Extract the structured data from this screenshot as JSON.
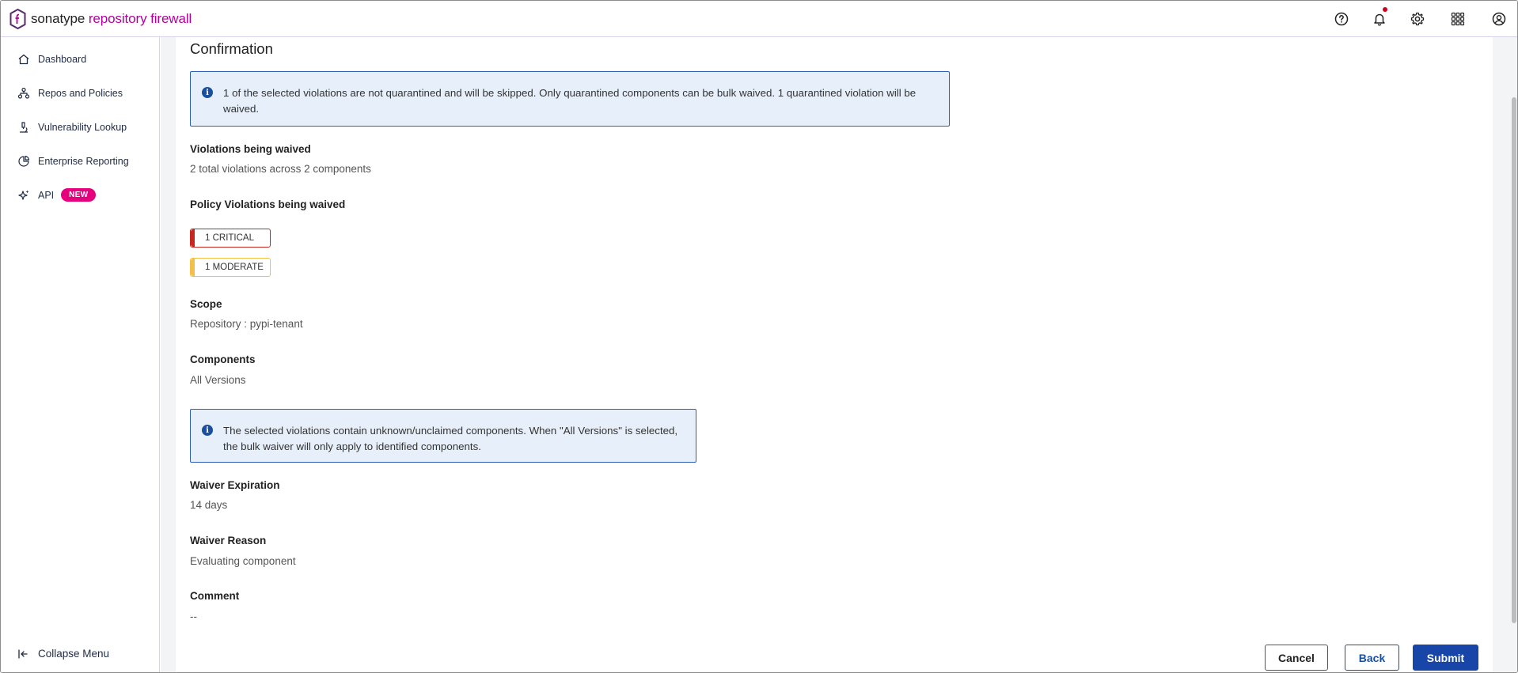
{
  "header": {
    "brand_part1": "sonatype",
    "brand_part2": "repository firewall",
    "icons": [
      "help-icon",
      "bell-icon",
      "gear-icon",
      "apps-grid-icon",
      "user-icon"
    ]
  },
  "sidebar": {
    "items": [
      {
        "label": "Dashboard",
        "icon": "home-icon"
      },
      {
        "label": "Repos and Policies",
        "icon": "hierarchy-icon"
      },
      {
        "label": "Vulnerability Lookup",
        "icon": "microscope-icon"
      },
      {
        "label": "Enterprise Reporting",
        "icon": "report-icon"
      },
      {
        "label": "API",
        "icon": "sparkle-icon",
        "badge": "NEW"
      }
    ],
    "collapse_label": "Collapse Menu"
  },
  "main": {
    "title": "Confirmation",
    "info1": "1 of the selected violations are not quarantined and will be skipped. Only quarantined components can be bulk waived. 1 quarantined violation will be waived.",
    "violations_label": "Violations being waived",
    "violations_value": "2 total violations across 2 components",
    "policy_label": "Policy Violations being waived",
    "severity": {
      "critical": "1 CRITICAL",
      "moderate": "1 MODERATE"
    },
    "scope_label": "Scope",
    "scope_value": "Repository : pypi-tenant",
    "components_label": "Components",
    "components_value": "All Versions",
    "info2": "The selected violations contain unknown/unclaimed components. When \"All Versions\" is selected, the bulk waiver will only apply to identified components.",
    "expiration_label": "Waiver Expiration",
    "expiration_value": "14 days",
    "reason_label": "Waiver Reason",
    "reason_value": "Evaluating component",
    "comment_label": "Comment",
    "comment_value": "--"
  },
  "buttons": {
    "cancel": "Cancel",
    "back": "Back",
    "submit": "Submit"
  },
  "colors": {
    "brand": "#b3009c",
    "primary": "#1846a8",
    "critical": "#c6281f",
    "moderate": "#f2c04a",
    "badge": "#e6007e"
  }
}
